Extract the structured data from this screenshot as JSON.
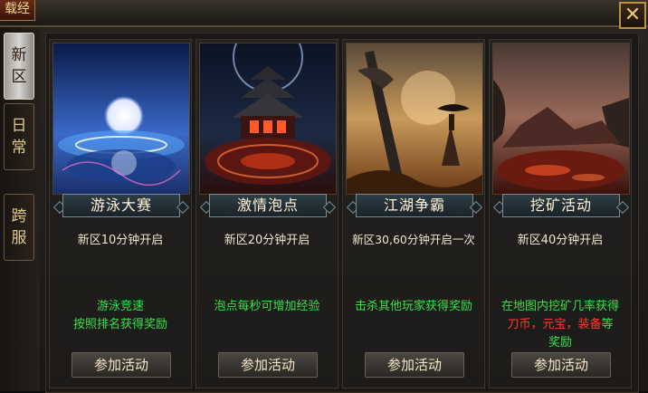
{
  "window": {
    "title_fragment": "载经",
    "close_label": "✕"
  },
  "sidebar": {
    "tabs": [
      {
        "label_line1": "新",
        "label_line2": "区",
        "active": true
      },
      {
        "label_line1": "日",
        "label_line2": "常",
        "active": false
      },
      {
        "label_line1": "跨",
        "label_line2": "服",
        "active": false
      }
    ]
  },
  "cards": [
    {
      "title": "游泳大赛",
      "open_time": "新区10分钟开启",
      "desc_line1": "游泳竞速",
      "desc_line2": "按照排名获得奖励",
      "join_label": "参加活动"
    },
    {
      "title": "激情泡点",
      "open_time": "新区20分钟开启",
      "desc_line1": "泡点每秒可增加经验",
      "join_label": "参加活动"
    },
    {
      "title": "江湖争霸",
      "open_time": "新区30,60分钟开启一次",
      "desc_line1": "击杀其他玩家获得奖励",
      "join_label": "参加活动"
    },
    {
      "title": "挖矿活动",
      "open_time": "新区40分钟开启",
      "desc_line1": "在地图内挖矿几率获得",
      "desc_red": "刀币，元宝，装备",
      "desc_tail": "等",
      "desc_line3": "奖励",
      "join_label": "参加活动"
    }
  ],
  "colors": {
    "accent_green": "#38e04a",
    "accent_red": "#ff3a2a",
    "gold": "#e8c77a"
  }
}
